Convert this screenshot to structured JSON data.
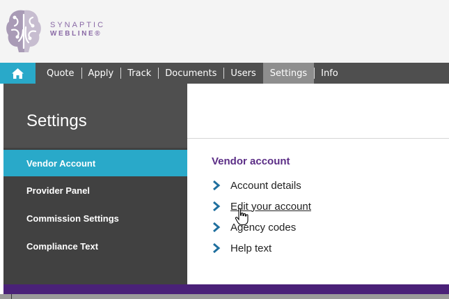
{
  "logo": {
    "line1": "SYNAPTIC",
    "line2": "WEBLINE®"
  },
  "nav": {
    "items": [
      "Quote",
      "Apply",
      "Track",
      "Documents",
      "Users",
      "Settings",
      "Info"
    ],
    "active": "Settings"
  },
  "sidebar": {
    "title": "Settings",
    "items": [
      {
        "label": "Vendor Account"
      },
      {
        "label": "Provider Panel"
      },
      {
        "label": "Commission Settings"
      },
      {
        "label": "Compliance Text"
      }
    ]
  },
  "main": {
    "heading": "Vendor account",
    "links": [
      {
        "label": "Account details"
      },
      {
        "label": "Edit your account"
      },
      {
        "label": "Agency codes"
      },
      {
        "label": "Help text"
      }
    ]
  },
  "colors": {
    "accent": "#29a9c9",
    "nav_bg": "#4f4f4f",
    "purple": "#5b2d86"
  }
}
